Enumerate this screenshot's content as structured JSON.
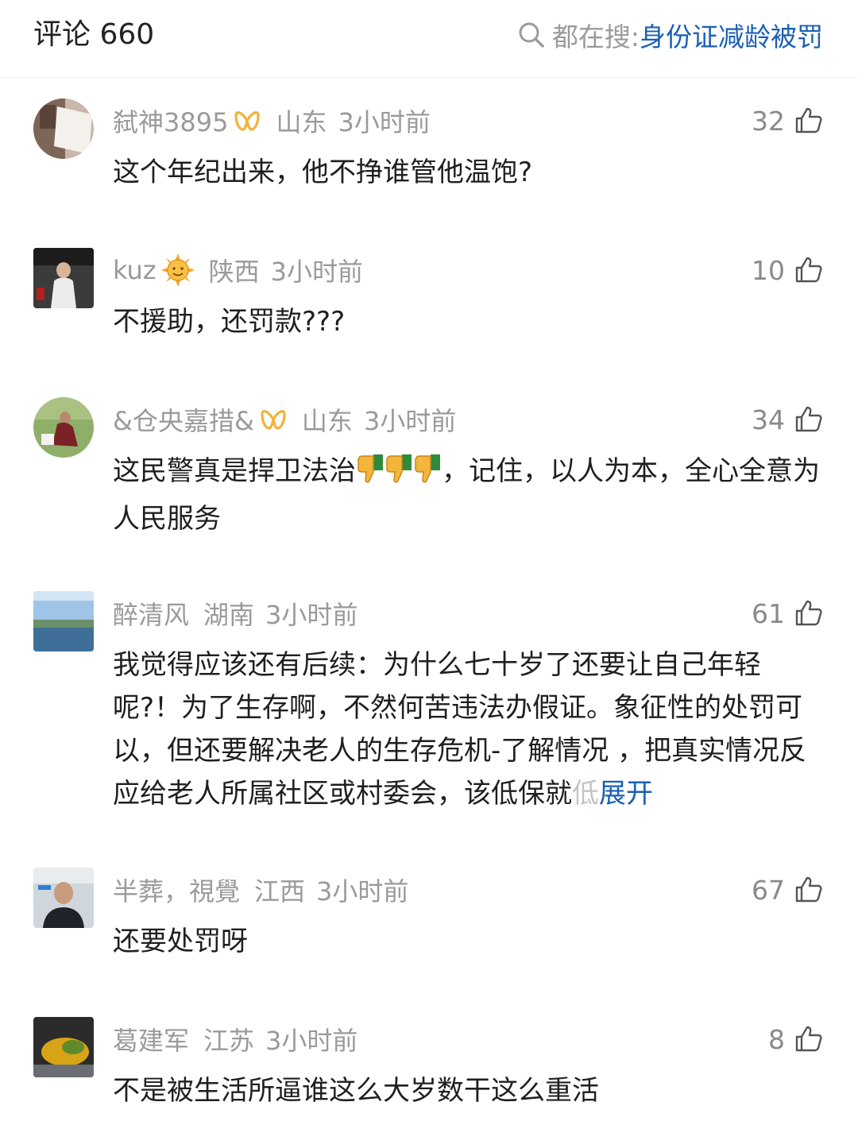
{
  "header": {
    "title": "评论 660",
    "search_prefix": "都在搜:",
    "search_query": "身份证减龄被罚",
    "query_color": "#1a5fb4"
  },
  "comments": [
    {
      "name": "弑神3895",
      "badge": "bow-badge-icon",
      "region": "山东",
      "time": "3小时前",
      "likes": "32",
      "text": "这个年纪出来，他不挣谁管他温饱?"
    },
    {
      "name": "kuz",
      "badge": "sun-emoji-icon",
      "region": "陕西",
      "time": "3小时前",
      "likes": "10",
      "text": "不援助，还罚款???"
    },
    {
      "name": "&仓央嘉措&",
      "badge": "bow-badge-icon",
      "region": "山东",
      "time": "3小时前",
      "likes": "34",
      "text_a": "这民警真是捍卫法治",
      "text_b": "，记住，以人为本，全心全意为人民服务"
    },
    {
      "name": "醉清风",
      "region": "湖南",
      "time": "3小时前",
      "likes": "61",
      "text_main": "我觉得应该还有后续：为什么七十岁了还要让自己年轻呢?！为了生存啊，不然何苦违法办假证。象征性的处罚可以，但还要解决老人的生存危机-了解情况 ，把真实情况反应给老人所属社区或村委会，该低保就",
      "text_fade": "低",
      "expand_label": "展开"
    },
    {
      "name": "半葬，視覺",
      "region": "江西",
      "time": "3小时前",
      "likes": "67",
      "text": "还要处罚呀"
    },
    {
      "name": "葛建军",
      "region": "江苏",
      "time": "3小时前",
      "likes": "8",
      "text": "不是被生活所逼谁这么大岁数干这么重活"
    }
  ]
}
